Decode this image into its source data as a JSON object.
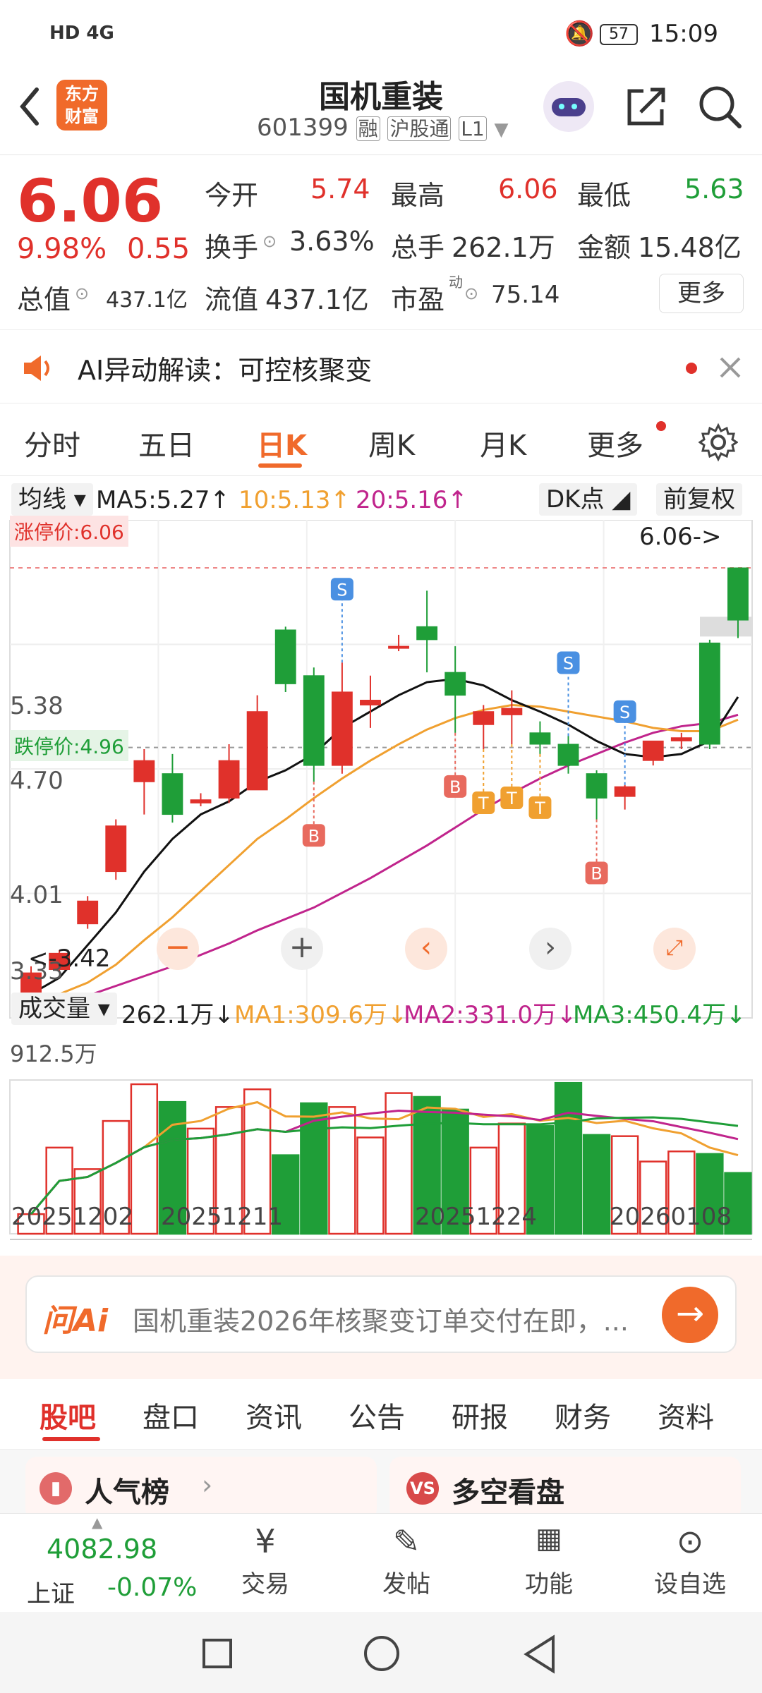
{
  "status": {
    "network": "HD 4G",
    "battery": "57",
    "time": "15:09"
  },
  "header": {
    "logo_line1": "东方",
    "logo_line2": "财富",
    "title": "国机重装",
    "code": "601399",
    "tag_margin": "融",
    "tag_connect": "沪股通",
    "tag_level": "L1"
  },
  "quote": {
    "price": "6.06",
    "pct": "9.98%",
    "change": "0.55",
    "open_label": "今开",
    "open": "5.74",
    "high_label": "最高",
    "high": "6.06",
    "low_label": "最低",
    "low": "5.63",
    "turnover_label": "换手",
    "turnover": "3.63%",
    "volume_label": "总手",
    "volume": "262.1万",
    "amount_label": "金额",
    "amount": "15.48亿",
    "mktcap_label": "总值",
    "mktcap": "437.1亿",
    "float_label": "流值",
    "float": "437.1亿",
    "pe_label": "市盈",
    "pe_sup": "动",
    "pe": "75.14",
    "more": "更多"
  },
  "ai_banner": {
    "text": "AI异动解读：可控核聚变"
  },
  "tabs": [
    "分时",
    "五日",
    "日K",
    "周K",
    "月K",
    "更多"
  ],
  "chart_bar": {
    "ma_select": "均线",
    "ma5": "MA5:5.27↑",
    "ma10": "10:5.13↑",
    "ma20": "20:5.16↑",
    "dk": "DK点",
    "adjust": "前复权"
  },
  "chart_labels": {
    "limit_up": "涨停价:6.06",
    "limit_down": "跌停价:4.96",
    "y1": "5.38",
    "y2": "4.70",
    "y3": "4.01",
    "y4": "3.33",
    "high_mark": "6.06->",
    "low_mark": "<-3.42"
  },
  "vol_bar": {
    "select": "成交量",
    "vol": "262.1万↓",
    "ma1": "MA1:309.6万↓",
    "ma2": "MA2:331.0万↓",
    "ma3": "MA3:450.4万↓",
    "ymax": "912.5万"
  },
  "dates": [
    "20251202",
    "20251211",
    "20251224",
    "20260108"
  ],
  "ask": {
    "brand": "问Ai",
    "text": "国机重装2026年核聚变订单交付在即，..."
  },
  "subtabs": [
    "股吧",
    "盘口",
    "资讯",
    "公告",
    "研报",
    "财务",
    "资料"
  ],
  "cards": {
    "left": "人气榜",
    "right": "多空看盘"
  },
  "index": {
    "value": "4082.98",
    "name": "上证",
    "pct": "-0.07%"
  },
  "bottom_items": [
    "交易",
    "发帖",
    "功能",
    "设自选"
  ],
  "colors": {
    "up": "#e0312b",
    "down": "#1f9e38",
    "accent": "#f06a2b"
  },
  "chart_data": {
    "type": "candlestick",
    "ylim": [
      3.33,
      6.06
    ],
    "ohlc": [
      [
        3.4,
        3.62,
        3.42,
        3.58
      ],
      [
        3.6,
        3.72,
        3.58,
        3.7
      ],
      [
        3.88,
        4.05,
        3.85,
        4.02
      ],
      [
        4.2,
        4.52,
        4.15,
        4.48
      ],
      [
        4.75,
        4.95,
        4.55,
        4.88
      ],
      [
        4.8,
        4.92,
        4.5,
        4.55
      ],
      [
        4.62,
        4.68,
        4.6,
        4.64
      ],
      [
        4.65,
        4.98,
        4.62,
        4.88
      ],
      [
        4.7,
        5.28,
        4.7,
        5.18
      ],
      [
        5.68,
        5.7,
        5.3,
        5.35
      ],
      [
        5.4,
        5.45,
        4.75,
        4.85
      ],
      [
        4.85,
        5.48,
        4.8,
        5.3
      ],
      [
        5.22,
        5.4,
        5.08,
        5.25
      ],
      [
        5.58,
        5.65,
        5.55,
        5.58
      ],
      [
        5.7,
        5.92,
        5.42,
        5.62
      ],
      [
        5.42,
        5.58,
        5.05,
        5.28
      ],
      [
        5.1,
        5.22,
        4.95,
        5.18
      ],
      [
        5.16,
        5.31,
        4.98,
        5.2
      ],
      [
        5.05,
        5.12,
        4.92,
        4.98
      ],
      [
        4.98,
        5.03,
        4.8,
        4.85
      ],
      [
        4.8,
        4.82,
        4.52,
        4.65
      ],
      [
        4.66,
        4.73,
        4.58,
        4.72
      ],
      [
        4.88,
        5.0,
        4.85,
        5.0
      ],
      [
        5.0,
        5.05,
        4.95,
        5.02
      ],
      [
        5.6,
        5.62,
        4.95,
        4.98
      ],
      [
        6.06,
        6.06,
        5.63,
        5.74
      ]
    ],
    "ma5": [
      3.45,
      3.55,
      3.75,
      3.95,
      4.2,
      4.4,
      4.55,
      4.63,
      4.75,
      4.82,
      4.92,
      5.08,
      5.18,
      5.28,
      5.36,
      5.38,
      5.34,
      5.25,
      5.18,
      5.1,
      5.0,
      4.92,
      4.9,
      4.92,
      5.0,
      5.27
    ],
    "ma10": [
      3.4,
      3.45,
      3.52,
      3.63,
      3.78,
      3.92,
      4.08,
      4.24,
      4.4,
      4.52,
      4.65,
      4.77,
      4.88,
      4.98,
      5.07,
      5.14,
      5.19,
      5.22,
      5.21,
      5.18,
      5.15,
      5.12,
      5.08,
      5.06,
      5.06,
      5.13
    ],
    "ma20": [
      3.38,
      3.4,
      3.44,
      3.5,
      3.56,
      3.62,
      3.69,
      3.76,
      3.84,
      3.91,
      3.98,
      4.07,
      4.16,
      4.26,
      4.36,
      4.47,
      4.58,
      4.68,
      4.77,
      4.85,
      4.92,
      4.99,
      5.05,
      5.09,
      5.11,
      5.16
    ],
    "volume": [
      155,
      680,
      510,
      890,
      1180,
      1040,
      830,
      1000,
      1140,
      620,
      1030,
      1000,
      760,
      1110,
      1080,
      980,
      680,
      870,
      850,
      1190,
      780,
      770,
      570,
      650,
      630,
      480
    ],
    "vol_ymax": 1180,
    "signals": [
      {
        "i": 10,
        "t": "B"
      },
      {
        "i": 11,
        "t": "S"
      },
      {
        "i": 15,
        "t": "B"
      },
      {
        "i": 16,
        "t": "T"
      },
      {
        "i": 17,
        "t": "T"
      },
      {
        "i": 18,
        "t": "T"
      },
      {
        "i": 19,
        "t": "S"
      },
      {
        "i": 20,
        "t": "B"
      },
      {
        "i": 21,
        "t": "S"
      }
    ]
  }
}
